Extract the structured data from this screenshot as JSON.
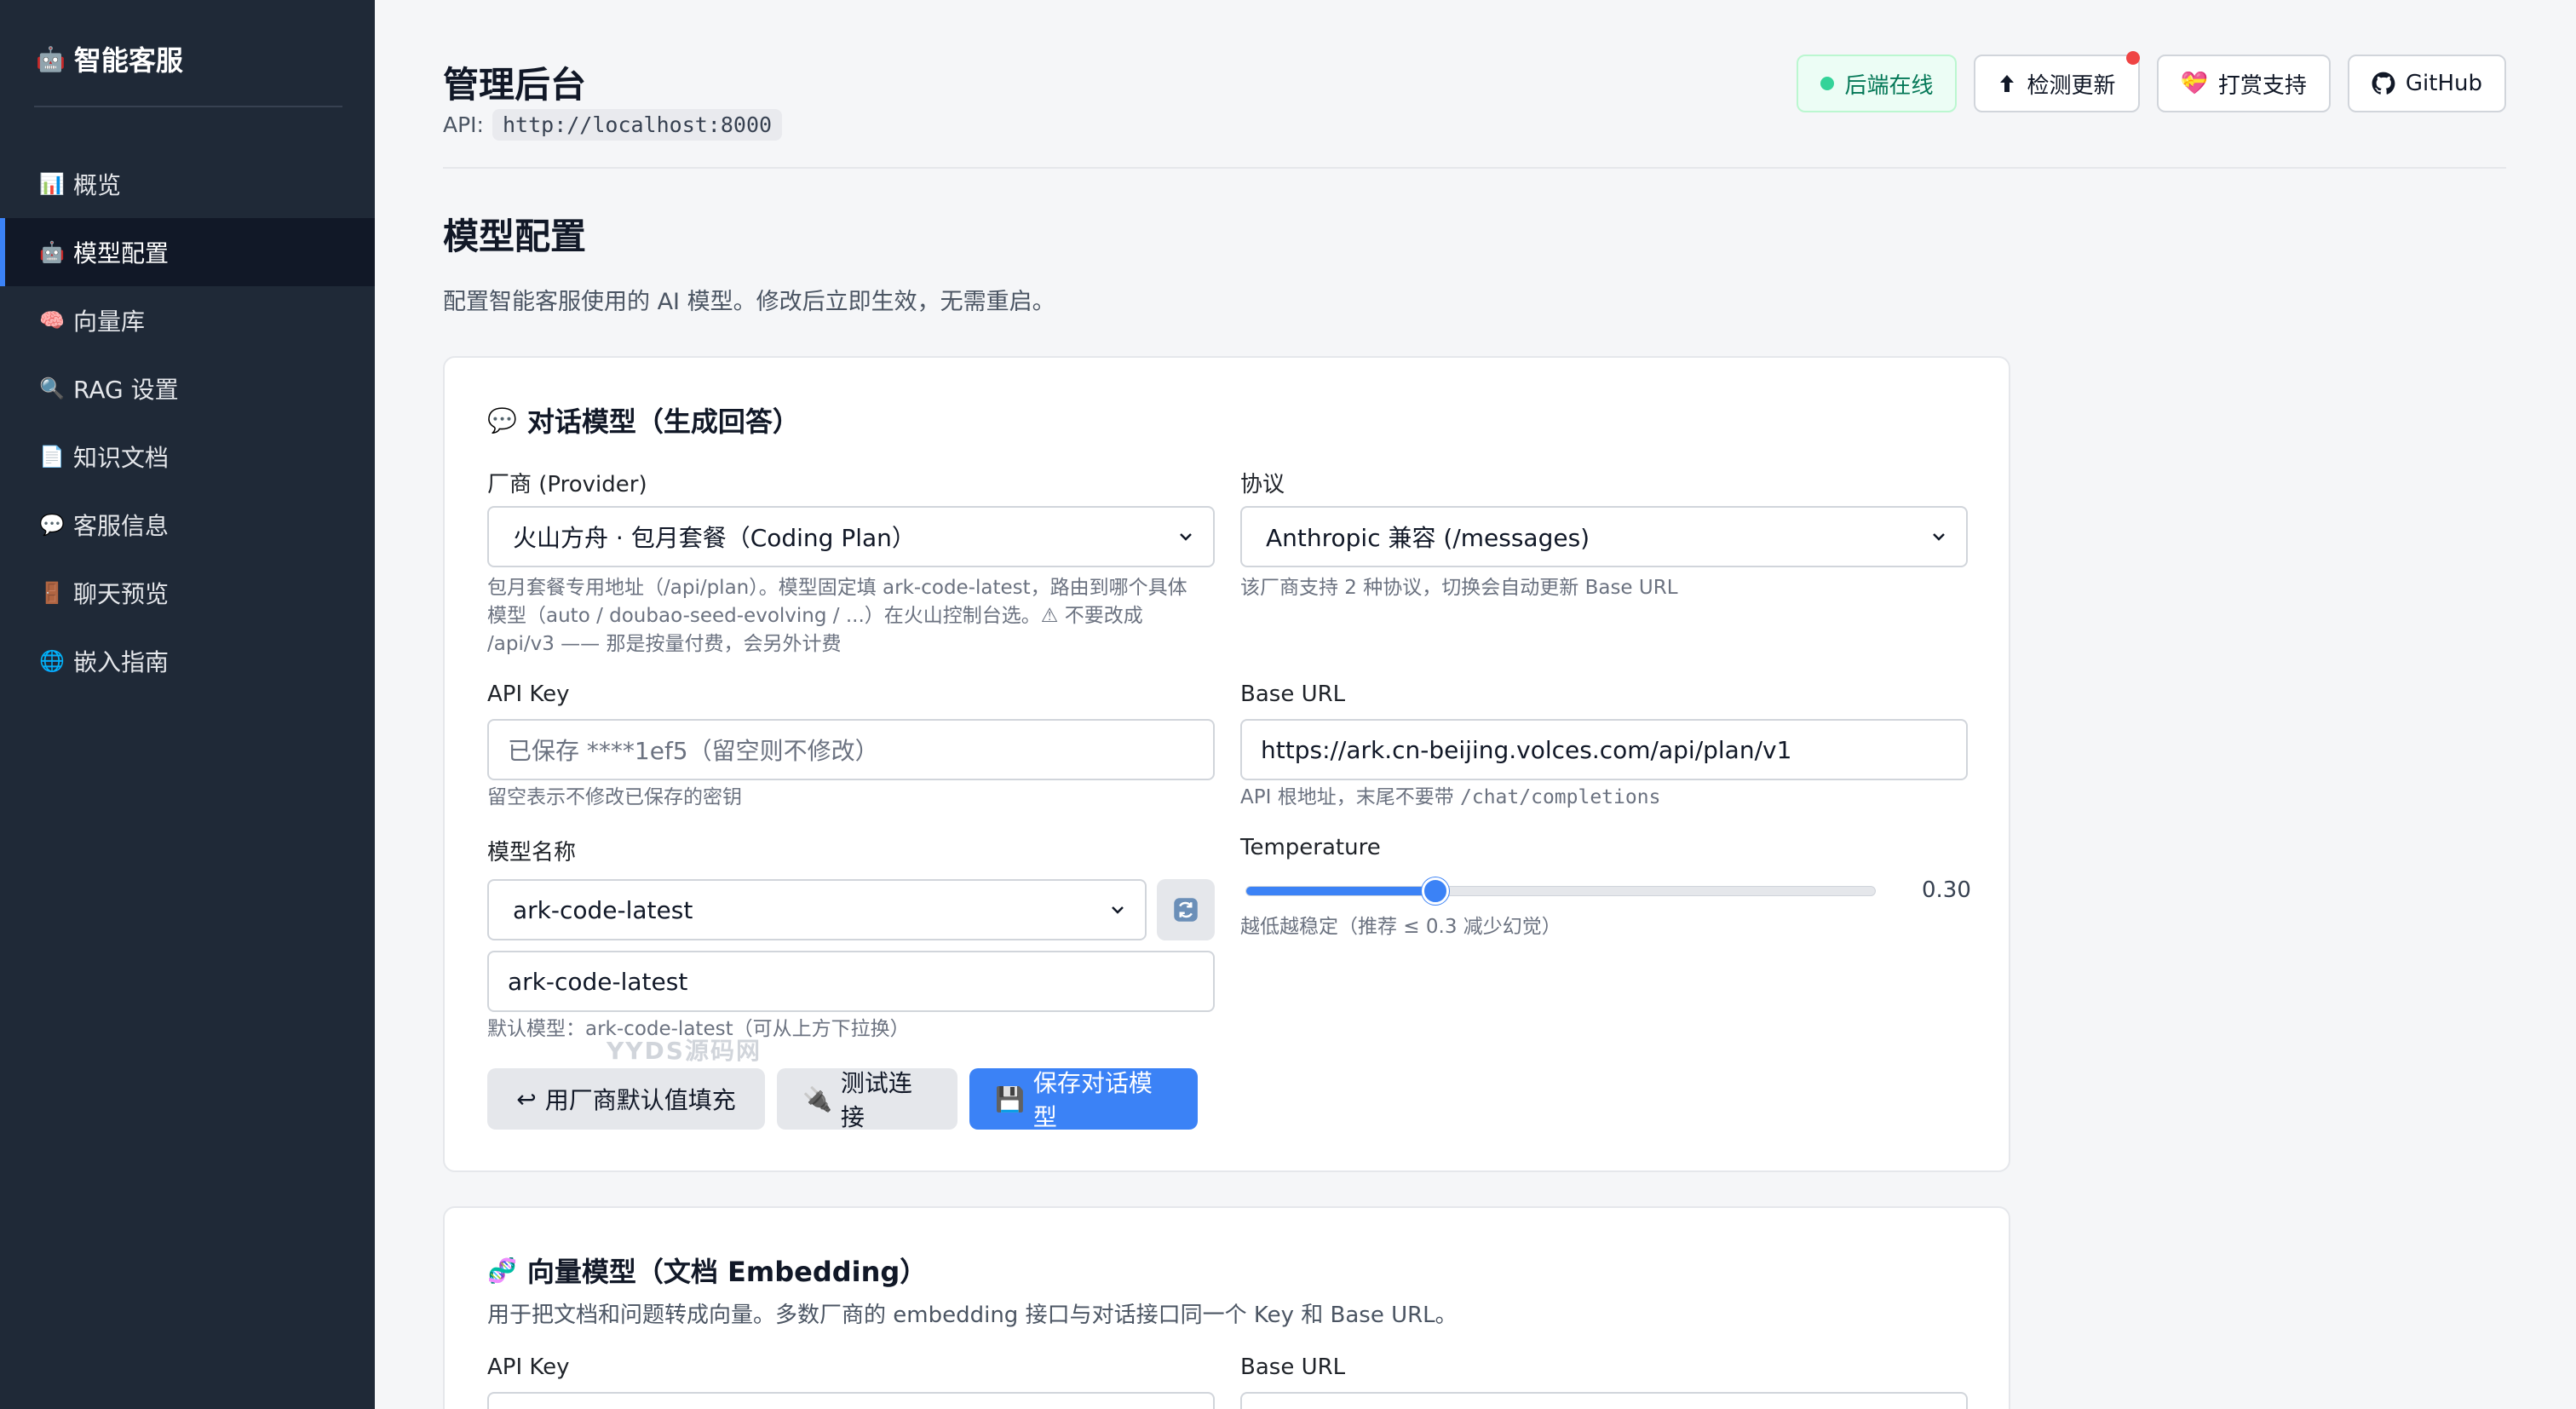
{
  "sidebar": {
    "brand": "智能客服",
    "items": [
      {
        "label": "概览",
        "icon": "📊"
      },
      {
        "label": "模型配置",
        "icon": "🤖"
      },
      {
        "label": "向量库",
        "icon": "🧠"
      },
      {
        "label": "RAG 设置",
        "icon": "🔍"
      },
      {
        "label": "知识文档",
        "icon": "📄"
      },
      {
        "label": "客服信息",
        "icon": "💬"
      },
      {
        "label": "聊天预览",
        "icon": "🚪"
      },
      {
        "label": "嵌入指南",
        "icon": "🌐"
      }
    ],
    "active_index": 1
  },
  "header": {
    "title": "管理后台",
    "api_label": "API:",
    "api_url": "http://localhost:8000",
    "status": "后端在线",
    "check_update": "检测更新",
    "support": "打赏支持",
    "github": "GitHub"
  },
  "section": {
    "title": "模型配置",
    "desc": "配置智能客服使用的 AI 模型。修改后立即生效，无需重启。"
  },
  "chat_model": {
    "title": "对话模型（生成回答）",
    "provider_label": "厂商 (Provider)",
    "provider_value": "火山方舟 · 包月套餐（Coding Plan）",
    "provider_hint_1": "包月套餐专用地址（/api/plan）。模型固定填 ark-code-latest，路由到哪个具体",
    "provider_hint_2": "模型（auto / doubao-seed-evolving / ...）在火山控制台选。⚠ 不要改成",
    "provider_hint_3": "/api/v3 —— 那是按量付费，会另外计费",
    "protocol_label": "协议",
    "protocol_value": "Anthropic 兼容 (/messages)",
    "protocol_hint": "该厂商支持 2 种协议，切换会自动更新 Base URL",
    "apikey_label": "API Key",
    "apikey_placeholder": "已保存 ****1ef5（留空则不修改）",
    "apikey_hint": "留空表示不修改已保存的密钥",
    "baseurl_label": "Base URL",
    "baseurl_value": "https://ark.cn-beijing.volces.com/api/plan/v1",
    "baseurl_hint_prefix": "API 根地址，末尾不要带",
    "baseurl_hint_code": "/chat/completions",
    "model_label": "模型名称",
    "model_select": "ark-code-latest",
    "model_input": "ark-code-latest",
    "model_hint": "默认模型：ark-code-latest（可从上方下拉换）",
    "temp_label": "Temperature",
    "temp_value": "0.30",
    "temp_fraction": 0.3,
    "temp_hint": "越低越稳定（推荐 ≤ 0.3 减少幻觉）",
    "btn_default": "用厂商默认值填充",
    "btn_test": "测试连接",
    "btn_save": "保存对话模型",
    "watermark": "YYDS源码网"
  },
  "embed_model": {
    "title": "向量模型（文档 Embedding）",
    "desc": "用于把文档和问题转成向量。多数厂商的 embedding 接口与对话接口同一个 Key 和 Base URL。",
    "apikey_label": "API Key",
    "baseurl_label": "Base URL"
  }
}
